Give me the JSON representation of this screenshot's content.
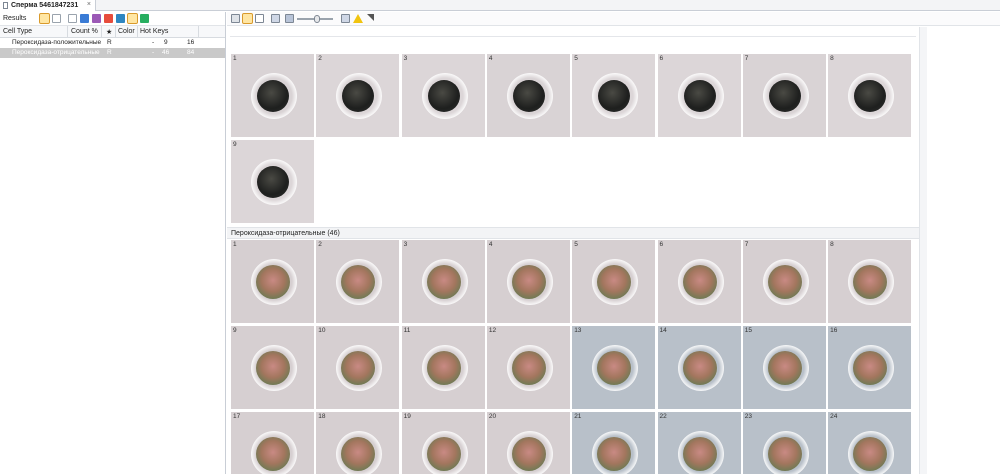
{
  "tab": {
    "title": "Сперма 5461847231",
    "close": "×"
  },
  "left": {
    "results_label": "Results",
    "columns": {
      "cell_type": "Cell Type",
      "count_pct": "Count %",
      "star": "★",
      "color": "Color",
      "hot_keys": "Hot Keys"
    },
    "rows": [
      {
        "cell_type": "Пероксидаза-положительные",
        "letter": "R",
        "dash": "-",
        "count": "9",
        "percent": "16",
        "selected": false
      },
      {
        "cell_type": "Пероксидаза-отрицательные",
        "letter": "R",
        "dash": "-",
        "count": "46",
        "percent": "84",
        "selected": true
      }
    ]
  },
  "right": {
    "toolbar_icons": [
      "grid-icon",
      "grid-large-icon",
      "list-icon",
      "copy-icon",
      "image-icon",
      "zoom-slider",
      "fit-icon",
      "warning-icon",
      "corner-icon"
    ],
    "zoom_level": 0.5,
    "group_positive": {
      "numbers": [
        "1",
        "2",
        "3",
        "4",
        "5",
        "6",
        "7",
        "8",
        "9"
      ]
    },
    "group_negative": {
      "header": "Пероксидаза-отрицательные (46)",
      "numbers": [
        "1",
        "2",
        "3",
        "4",
        "5",
        "6",
        "7",
        "8",
        "9",
        "10",
        "11",
        "12",
        "13",
        "14",
        "15",
        "16",
        "17",
        "18",
        "19",
        "20",
        "21",
        "22",
        "23",
        "24"
      ]
    }
  },
  "colors": {
    "accent_selected_bg": "#ffe6a3",
    "selected_row": "#c9c9c9",
    "tile_bg_pink": "#d8cfd1",
    "tile_bg_gray": "#b9c0c8",
    "dark_cell": "#2b2c2c"
  }
}
